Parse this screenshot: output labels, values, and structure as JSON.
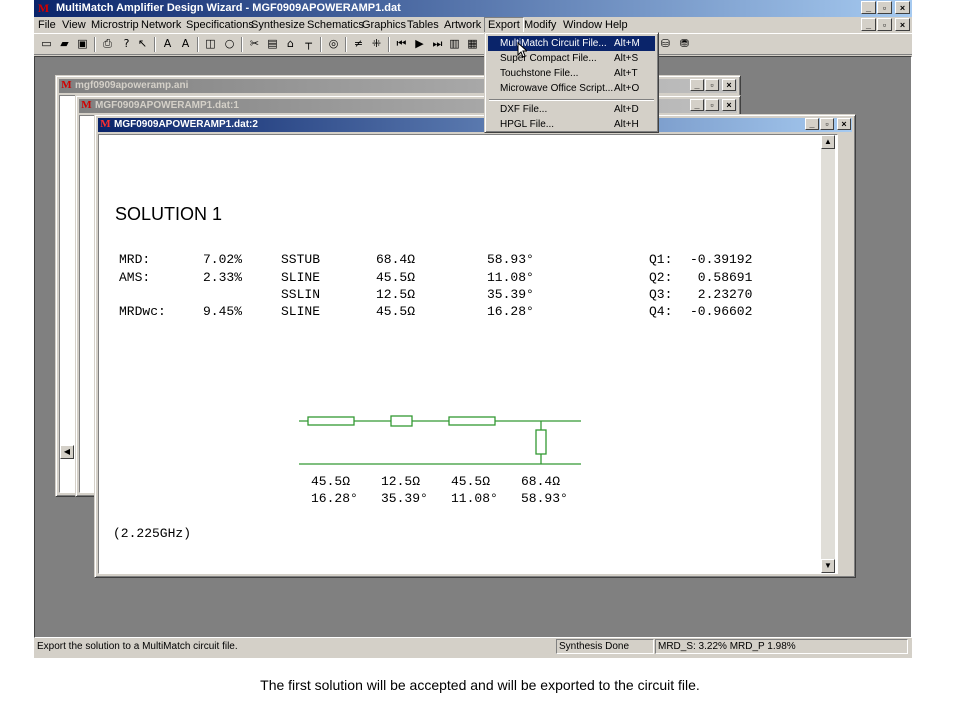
{
  "app": {
    "title": "MultiMatch Amplifier Design Wizard - MGF0909APOWERAMP1.dat",
    "logo_letter": "M"
  },
  "menubar": [
    "File",
    "View",
    "Microstrip",
    "Network",
    "Specifications",
    "Synthesize",
    "Schematics",
    "Graphics",
    "Tables",
    "Artwork",
    "Export",
    "Modify",
    "Window",
    "Help"
  ],
  "export_menu": {
    "items": [
      {
        "label": "MultiMatch Circuit File...",
        "shortcut": "Alt+M",
        "highlighted": true
      },
      {
        "label": "Super Compact File...",
        "shortcut": "Alt+S"
      },
      {
        "label": "Touchstone File...",
        "shortcut": "Alt+T"
      },
      {
        "label": "Microwave Office Script...",
        "shortcut": "Alt+O"
      },
      {
        "label": "DXF File...",
        "shortcut": "Alt+D"
      },
      {
        "label": "HPGL File...",
        "shortcut": "Alt+H"
      }
    ]
  },
  "windows": {
    "w1_title": "mgf0909apoweramp.ani",
    "w2_title": "MGF0909APOWERAMP1.dat:1",
    "w3_title": "MGF0909APOWERAMP1.dat:2"
  },
  "solution": {
    "title": "SOLUTION 1",
    "rows": [
      {
        "name": "MRD:",
        "value": "7.02%",
        "type": "SSTUB",
        "z": "68.4Ω",
        "angle": "58.93°",
        "qname": "Q1:",
        "q": "-0.39192"
      },
      {
        "name": "AMS:",
        "value": "2.33%",
        "type": "SLINE",
        "z": "45.5Ω",
        "angle": "11.08°",
        "qname": "Q2:",
        "q": " 0.58691"
      },
      {
        "name": "",
        "value": "",
        "type": "SSLIN",
        "z": "12.5Ω",
        "angle": "35.39°",
        "qname": "Q3:",
        "q": " 2.23270"
      },
      {
        "name": "MRDwc:",
        "value": "9.45%",
        "type": "SLINE",
        "z": "45.5Ω",
        "angle": "16.28°",
        "qname": "Q4:",
        "q": "-0.96602"
      }
    ],
    "schematic_labels": [
      {
        "z": "45.5Ω",
        "angle": "16.28°"
      },
      {
        "z": "12.5Ω",
        "angle": "35.39°"
      },
      {
        "z": "45.5Ω",
        "angle": "11.08°"
      },
      {
        "z": "68.4Ω",
        "angle": "58.93°"
      }
    ],
    "frequency": "(2.225GHz)"
  },
  "statusbar": {
    "message": "Export the solution to a MultiMatch circuit file.",
    "state": "Synthesis Done",
    "mrd": "MRD_S: 3.22% MRD_P  1.98%"
  },
  "caption": "The first solution will be accepted and will be exported to the circuit file."
}
